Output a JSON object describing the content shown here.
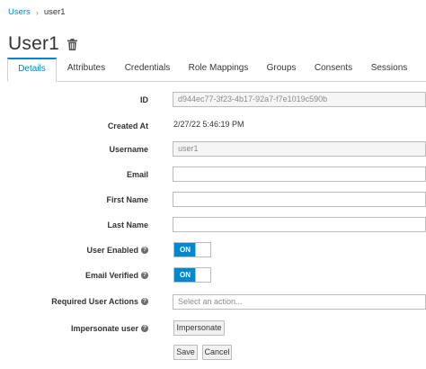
{
  "breadcrumb": {
    "parent": "Users",
    "separator": "›",
    "current": "user1"
  },
  "page": {
    "title": "User1",
    "delete_icon": "trash-icon"
  },
  "tabs": [
    {
      "label": "Details",
      "active": true
    },
    {
      "label": "Attributes"
    },
    {
      "label": "Credentials"
    },
    {
      "label": "Role Mappings"
    },
    {
      "label": "Groups"
    },
    {
      "label": "Consents"
    },
    {
      "label": "Sessions"
    }
  ],
  "form": {
    "id": {
      "label": "ID",
      "value": "d944ec77-3f23-4b17-92a7-f7e1019c590b"
    },
    "created_at": {
      "label": "Created At",
      "value": "2/27/22 5:46:19 PM"
    },
    "username": {
      "label": "Username",
      "value": "user1"
    },
    "email": {
      "label": "Email",
      "value": ""
    },
    "first_name": {
      "label": "First Name",
      "value": ""
    },
    "last_name": {
      "label": "Last Name",
      "value": ""
    },
    "user_enabled": {
      "label": "User Enabled",
      "state": "ON"
    },
    "email_verified": {
      "label": "Email Verified",
      "state": "ON"
    },
    "required_actions": {
      "label": "Required User Actions",
      "placeholder": "Select an action..."
    },
    "impersonate": {
      "label": "Impersonate user",
      "button": "Impersonate"
    },
    "help_glyph": "?"
  },
  "actions": {
    "save": "Save",
    "cancel": "Cancel"
  },
  "colors": {
    "accent": "#0088ce",
    "border": "#bbbbbb",
    "readonly_bg": "#f5f5f5"
  }
}
